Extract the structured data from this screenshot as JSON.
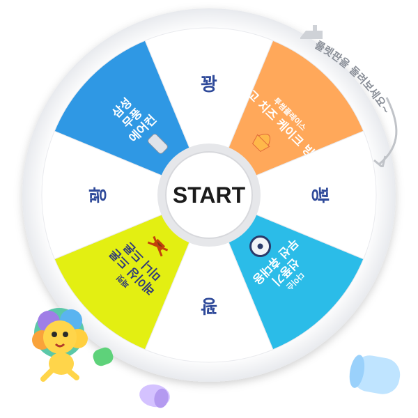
{
  "wheel": {
    "start_label": "START",
    "prizes": [
      {
        "label": [
          "꽝"
        ],
        "color": "#ffffff",
        "text_color": "#2f4a9a",
        "icon": "none"
      },
      {
        "label": [
          "망고 치즈 케이크 빙수"
        ],
        "sub": "투썸플레이스",
        "color": "#ffa85a",
        "text_color": "#ffffff",
        "icon": "cake-icon"
      },
      {
        "label": [
          "꽝"
        ],
        "color": "#ffffff",
        "text_color": "#2f4a9a",
        "icon": "none"
      },
      {
        "label": [
          "선풍기",
          "무선 휴대용"
        ],
        "sub": "다이슨",
        "color": "#2bbce8",
        "text_color": "#ffffff",
        "icon": "fan-icon"
      },
      {
        "label": [
          "꽝"
        ],
        "color": "#ffffff",
        "text_color": "#2f4a9a",
        "icon": "none"
      },
      {
        "label": [
          "레이싱 드론",
          "미니 드론"
        ],
        "sub": "패럿",
        "color": "#e3ef12",
        "text_color": "#2f3a7a",
        "icon": "drone-icon"
      },
      {
        "label": [
          "꽝"
        ],
        "color": "#ffffff",
        "text_color": "#2f4a9a",
        "icon": "none"
      },
      {
        "label": [
          "삼성",
          "무풍",
          "에어컨"
        ],
        "sub": "",
        "color": "#2f98e4",
        "text_color": "#ffffff",
        "icon": "aircon-icon"
      }
    ]
  },
  "hint": {
    "text": "룰렛판을 돌려보세요~",
    "icon": "pointer-hand-icon"
  },
  "decor": {
    "mascot": "lion-mascot",
    "capsules": [
      "green",
      "purple",
      "blue"
    ]
  }
}
